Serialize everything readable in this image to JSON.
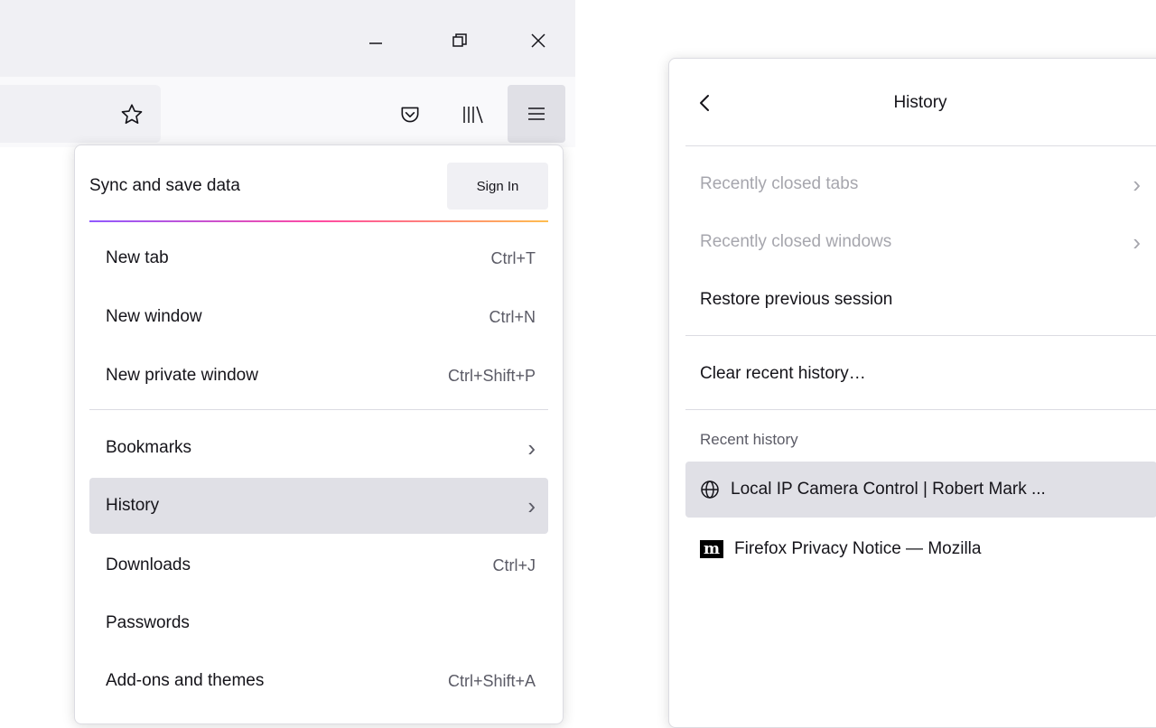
{
  "window_controls": {
    "minimize": "—",
    "restore": "⧉",
    "close": "✕"
  },
  "toolbar": {
    "icons": [
      "bookmark-star-icon",
      "pocket-icon",
      "library-icon",
      "hamburger-menu-icon"
    ]
  },
  "app_menu": {
    "sync_label": "Sync and save data",
    "sign_in_label": "Sign In",
    "items": [
      {
        "label": "New tab",
        "shortcut": "Ctrl+T"
      },
      {
        "label": "New window",
        "shortcut": "Ctrl+N"
      },
      {
        "label": "New private window",
        "shortcut": "Ctrl+Shift+P"
      },
      {
        "label": "Bookmarks",
        "shortcut": ""
      },
      {
        "label": "History",
        "shortcut": ""
      },
      {
        "label": "Downloads",
        "shortcut": "Ctrl+J"
      },
      {
        "label": "Passwords",
        "shortcut": ""
      },
      {
        "label": "Add-ons and themes",
        "shortcut": "Ctrl+Shift+A"
      }
    ]
  },
  "history_panel": {
    "title": "History",
    "recently_closed_tabs": "Recently closed tabs",
    "recently_closed_windows": "Recently closed windows",
    "restore_session": "Restore previous session",
    "clear_history": "Clear recent history…",
    "recent_heading": "Recent history",
    "entries": [
      {
        "title": "Local IP Camera Control | Robert Mark ...",
        "favicon": "globe-icon"
      },
      {
        "title": "Firefox Privacy Notice — Mozilla",
        "favicon": "mozilla-m-icon",
        "favicon_text": "m"
      }
    ]
  },
  "colors": {
    "accent_gradient": [
      "#9059ff",
      "#ff4aa2",
      "#ffbd4f"
    ],
    "hover_bg": "#e0e0e6",
    "disabled_text": "#a6a6ad"
  }
}
